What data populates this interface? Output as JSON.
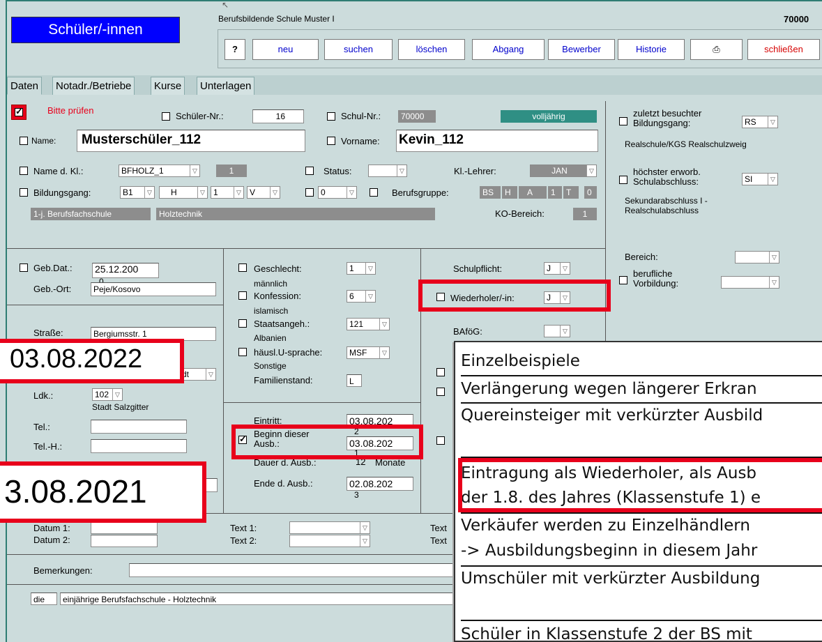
{
  "window": {
    "title": "Schüler/-innen",
    "school_name": "Berufsbildende Schule Muster I",
    "school_number": "70000"
  },
  "toolbar": {
    "help_icon": "question-icon",
    "new": "neu",
    "search": "suchen",
    "delete": "löschen",
    "leave": "Abgang",
    "applicant": "Bewerber",
    "history": "Historie",
    "print_icon": "printer-icon",
    "close": "schließen"
  },
  "tabs": [
    "Daten",
    "Notadr./Betriebe",
    "Kurse",
    "Unterlagen"
  ],
  "header": {
    "check_label": "Bitte prüfen",
    "student_nr_label": "Schüler-Nr.:",
    "student_nr": "16",
    "school_nr_label": "Schul-Nr.:",
    "school_nr": "70000",
    "adult_badge": "volljährig",
    "name_label": "Name:",
    "name": "Musterschüler_112",
    "firstname_label": "Vorname:",
    "firstname": "Kevin_112",
    "class_label": "Name d. Kl.:",
    "class": "BFHOLZ_1",
    "class_num": "1",
    "status_label": "Status:",
    "status": "",
    "teacher_label": "Kl.-Lehrer:",
    "teacher": "JAN",
    "course_label": "Bildungsgang:",
    "course_parts": [
      "B1",
      "H",
      "1",
      "V"
    ],
    "zero_sel": "0",
    "jobgroup_label": "Berufsgruppe:",
    "jobgroup_parts": [
      "BS",
      "H",
      "A",
      "1",
      "T"
    ],
    "jobgroup_num": "0",
    "course_desc": "1-j. Berufsfachschule",
    "course_desc2": "Holztechnik",
    "ko_label": "KO-Bereich:",
    "ko": "1"
  },
  "right_panel": {
    "last_course_label": "zuletzt besuchter Bildungsgang:",
    "last_course": "RS",
    "last_course_desc": "Realschule/KGS Realschulzweig",
    "highest_label": "höchster erworb. Schulabschluss:",
    "highest": "SI",
    "highest_desc": "Sekundarabschluss I - Realschulabschluss",
    "area_label": "Bereich:",
    "area": "",
    "prior_label": "berufliche Vorbildung:",
    "prior": ""
  },
  "personal": {
    "birth_label": "Geb.Dat.:",
    "birth": "25.12.200",
    "birth_wrap": "0",
    "birthplace_label": "Geb.-Ort:",
    "birthplace": "Peje/Kosovo",
    "street_label": "Straße:",
    "street": "Bergiumsstr. 1",
    "city_suffix": "dt",
    "ldk_label": "Ldk.:",
    "ldk": "102",
    "ldk_desc": "Stadt Salzgitter",
    "tel_label": "Tel.:",
    "telh_label": "Tel.-H.:",
    "datum1_label": "Datum 1:",
    "datum2_label": "Datum 2:"
  },
  "middle": {
    "gender_label": "Geschlecht:",
    "gender": "1",
    "gender_desc": "männlich",
    "religion_label": "Konfession:",
    "religion": "6",
    "religion_desc": "islamisch",
    "nation_label": "Staatsangeh.:",
    "nation": "121",
    "nation_desc": "Albanien",
    "language_label": "häusl.U-sprache:",
    "language": "MSF",
    "language_desc": "Sonstige",
    "family_label": "Familienstand:",
    "family": "L",
    "entry_label": "Eintritt:",
    "entry": "03.08.202",
    "entry_wrap": "2",
    "start_label": "Beginn dieser Ausb.:",
    "start": "03.08.202",
    "start_wrap": "1",
    "duration_label": "Dauer d. Ausb.:",
    "duration": "12",
    "duration_unit": "Monate",
    "end_label": "Ende d. Ausb.:",
    "end": "02.08.202",
    "end_wrap": "3",
    "text1_label": "Text 1:",
    "text2_label": "Text 2:",
    "text_label": "Text"
  },
  "right_mid": {
    "schoolduty_label": "Schulpflicht:",
    "schoolduty": "J",
    "repeater_label": "Wiederholer/-in:",
    "repeater": "J",
    "bafoeg_label": "BAföG:",
    "bafoeg": ""
  },
  "bottom": {
    "remarks_label": "Bemerkungen:",
    "remarks": "",
    "article": "die",
    "full_desc": "einjährige Berufsfachschule - Holztechnik"
  },
  "overlays": {
    "date_top": "03.08.2022",
    "date_bottom": "3.08.2021"
  },
  "popup": {
    "rows": [
      "Einzelbeispiele",
      "Verlängerung wegen längerer Erkran",
      "Quereinsteiger mit verkürzter Ausbild",
      "Eintragung als Wiederholer, als Ausb",
      "der 1.8. des Jahres (Klassenstufe 1) e",
      "Verkäufer werden zu Einzelhändlern",
      "-> Ausbildungsbeginn in diesem Jahr",
      "Umschüler mit verkürzter Ausbildung",
      "Schüler in Klassenstufe 2 der BS mit"
    ]
  },
  "colors": {
    "title_bg": "#0000ff",
    "highlight": "#e8001b",
    "badge": "#2f8f84",
    "form_bg": "#ccdcdc"
  }
}
